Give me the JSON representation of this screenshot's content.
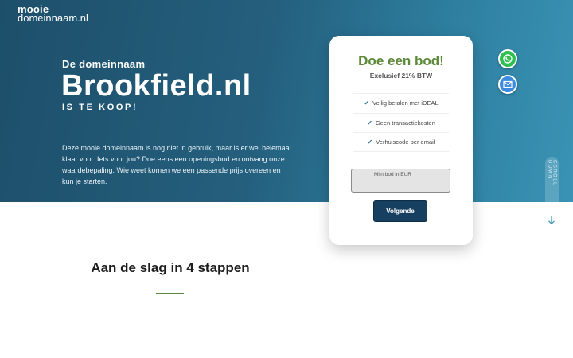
{
  "logo": {
    "line1": "mooie",
    "line2": "domeinnaam.nl"
  },
  "hero": {
    "subtitle": "De domeinnaam",
    "domain": "Brookfield.nl",
    "for_sale": "IS TE KOOP!",
    "description": "Deze mooie domeinnaam is nog niet in gebruik, maar is er wel helemaal klaar voor. Iets voor jou? Doe eens een openingsbod en ontvang onze waardebepaling. Wie weet komen we een passende prijs overeen en kun je starten."
  },
  "offer_card": {
    "title": "Doe een bod!",
    "subtitle": "Exclusief 21% BTW",
    "features": [
      "Veilig betalen met iDEAL",
      "Geen transactiekosten",
      "Verhuiscode per email"
    ],
    "bid_placeholder": "Mijn bod in EUR",
    "submit_label": "Volgende"
  },
  "floating": {
    "whatsapp_icon": "whatsapp-icon",
    "mail_icon": "mail-icon"
  },
  "scroll": {
    "label": "SCROLL DOWN"
  },
  "steps": {
    "title": "Aan de slag in 4 stappen"
  },
  "colors": {
    "accent_green": "#5d8a3a",
    "button_navy": "#173f5f",
    "hero_start": "#1d4f6a",
    "hero_end": "#3a93b4"
  }
}
